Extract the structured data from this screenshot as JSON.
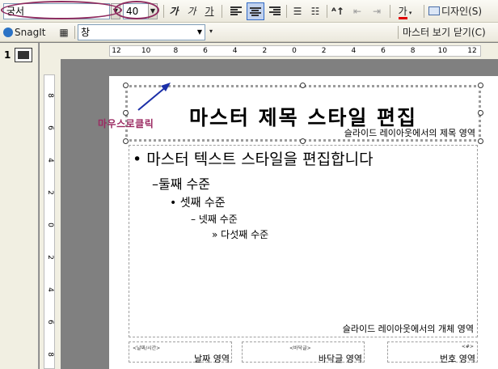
{
  "toolbar1": {
    "font_name": "궁서",
    "font_size": "40",
    "btn_font_grow": "가",
    "btn_font_shrink": "가",
    "btn_font_color_label": "가",
    "btn_design": "디자인(S)",
    "accent_ellipse": "#8e2a5e"
  },
  "toolbar2": {
    "snagit_label": "SnagIt",
    "window_label": "창",
    "close_master": "마스터 보기 닫기(C)"
  },
  "thumbnail": {
    "number": "1"
  },
  "hruler": [
    "12",
    "10",
    "8",
    "6",
    "4",
    "2",
    "0",
    "2",
    "4",
    "6",
    "8",
    "10",
    "12"
  ],
  "vruler": [
    "8",
    "6",
    "4",
    "2",
    "0",
    "2",
    "4",
    "6",
    "8"
  ],
  "slide": {
    "title": "마스터 제목 스타일 편집",
    "title_area": "슬라이드 레이아웃에서의 제목 영역",
    "levels": [
      "• 마스터 텍스트 스타일을 편집합니다",
      "–둘째 수준",
      "• 셋째 수준",
      "– 넷째 수준",
      "» 다섯째 수준"
    ],
    "body_area": "슬라이드 레이아웃에서의 개체 영역",
    "date_tiny": "<날짜/시간>",
    "date_area": "날짜 영역",
    "footer_tiny": "<바닥글>",
    "footer_area": "바닥글 영역",
    "number_tiny": "<#>",
    "number_area": "번호 영역"
  },
  "annotation": {
    "text": "마우스로클릭",
    "color": "#9b2a62"
  }
}
